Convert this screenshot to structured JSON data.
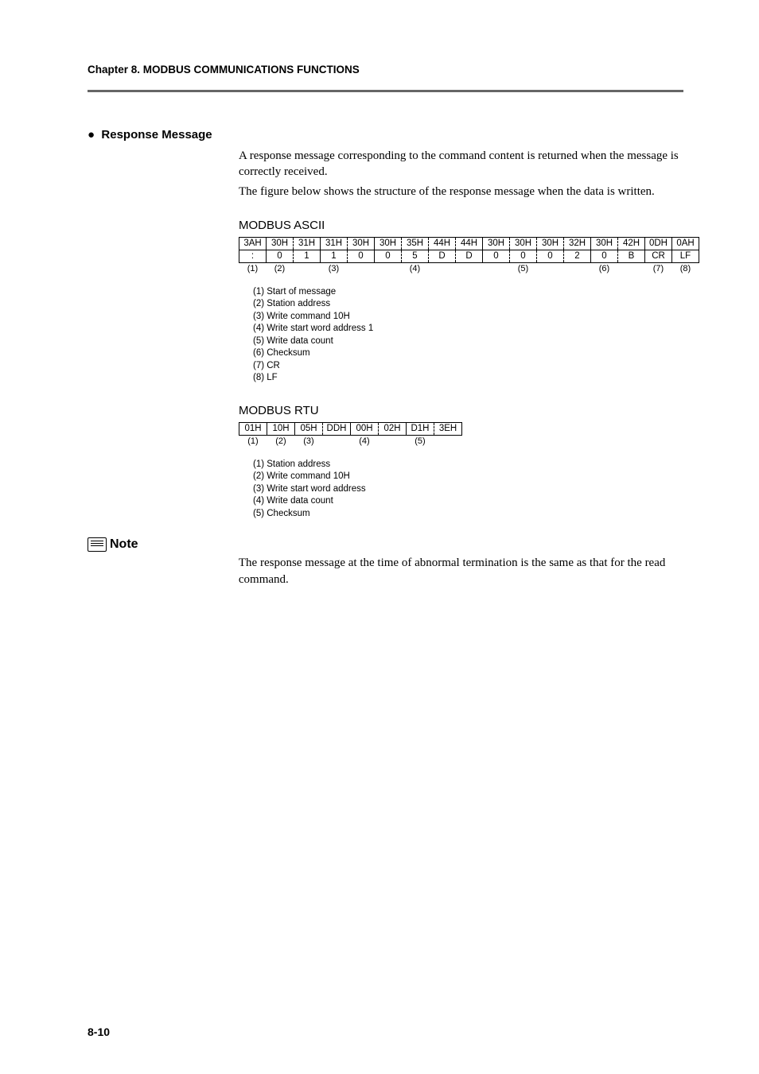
{
  "chapter": "Chapter 8. MODBUS COMMUNICATIONS FUNCTIONS",
  "section": {
    "bullet": "●",
    "title": "Response Message"
  },
  "paragraph1": "A response message corresponding to the command content is returned when the message is correctly received.",
  "paragraph2": "The figure below shows the structure of the response message when the data is written.",
  "ascii": {
    "title": "MODBUS ASCII",
    "hex": [
      "3AH",
      "30H",
      "31H",
      "31H",
      "30H",
      "30H",
      "35H",
      "44H",
      "44H",
      "30H",
      "30H",
      "30H",
      "32H",
      "30H",
      "42H",
      "0DH",
      "0AH"
    ],
    "char": [
      ":",
      "0",
      "1",
      "1",
      "0",
      "0",
      "5",
      "D",
      "D",
      "0",
      "0",
      "0",
      "2",
      "0",
      "B",
      "CR",
      "LF"
    ],
    "idx": [
      "(1)",
      "(2)",
      "",
      "(3)",
      "",
      "",
      "(4)",
      "",
      "",
      "",
      "(5)",
      "",
      "",
      "(6)",
      "",
      "(7)",
      "(8)"
    ],
    "legend": [
      "(1) Start of message",
      "(2) Station address",
      "(3) Write command 10H",
      "(4) Write start word address 1",
      "(5) Write data count",
      "(6) Checksum",
      "(7) CR",
      "(8) LF"
    ]
  },
  "rtu": {
    "title": "MODBUS RTU",
    "hex": [
      "01H",
      "10H",
      "05H",
      "DDH",
      "00H",
      "02H",
      "D1H",
      "3EH"
    ],
    "idx": [
      "(1)",
      "(2)",
      "(3)",
      "",
      "(4)",
      "",
      "(5)",
      ""
    ],
    "legend": [
      "(1) Station address",
      "(2) Write command 10H",
      "(3) Write start word address",
      "(4) Write data count",
      "(5) Checksum"
    ]
  },
  "note": {
    "label": "Note",
    "text": "The response message at the time of abnormal termination is the same as that for the read command."
  },
  "page_number": "8-10"
}
